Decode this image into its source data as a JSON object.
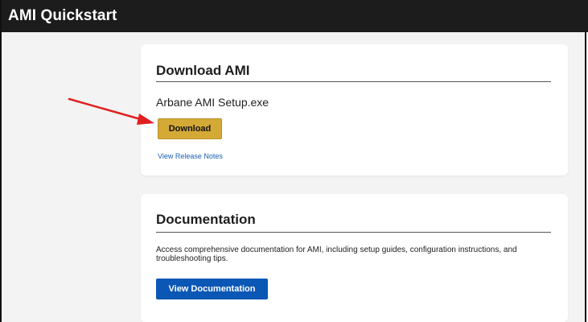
{
  "window": {
    "title": "AMI Quickstart"
  },
  "download_card": {
    "title": "Download AMI",
    "filename": "Arbane AMI Setup.exe",
    "download_label": "Download",
    "release_notes_label": "View Release Notes"
  },
  "docs_card": {
    "title": "Documentation",
    "description": "Access comprehensive documentation for AMI, including setup guides, configuration instructions, and troubleshooting tips.",
    "button_label": "View Documentation"
  },
  "colors": {
    "titlebar": "#1c1c1c",
    "download_button": "#d4a936",
    "docs_button": "#0b57b5",
    "link": "#1a5fb4",
    "annotation_arrow": "#e02020"
  },
  "icons": {
    "annotation": "red-arrow-icon"
  }
}
